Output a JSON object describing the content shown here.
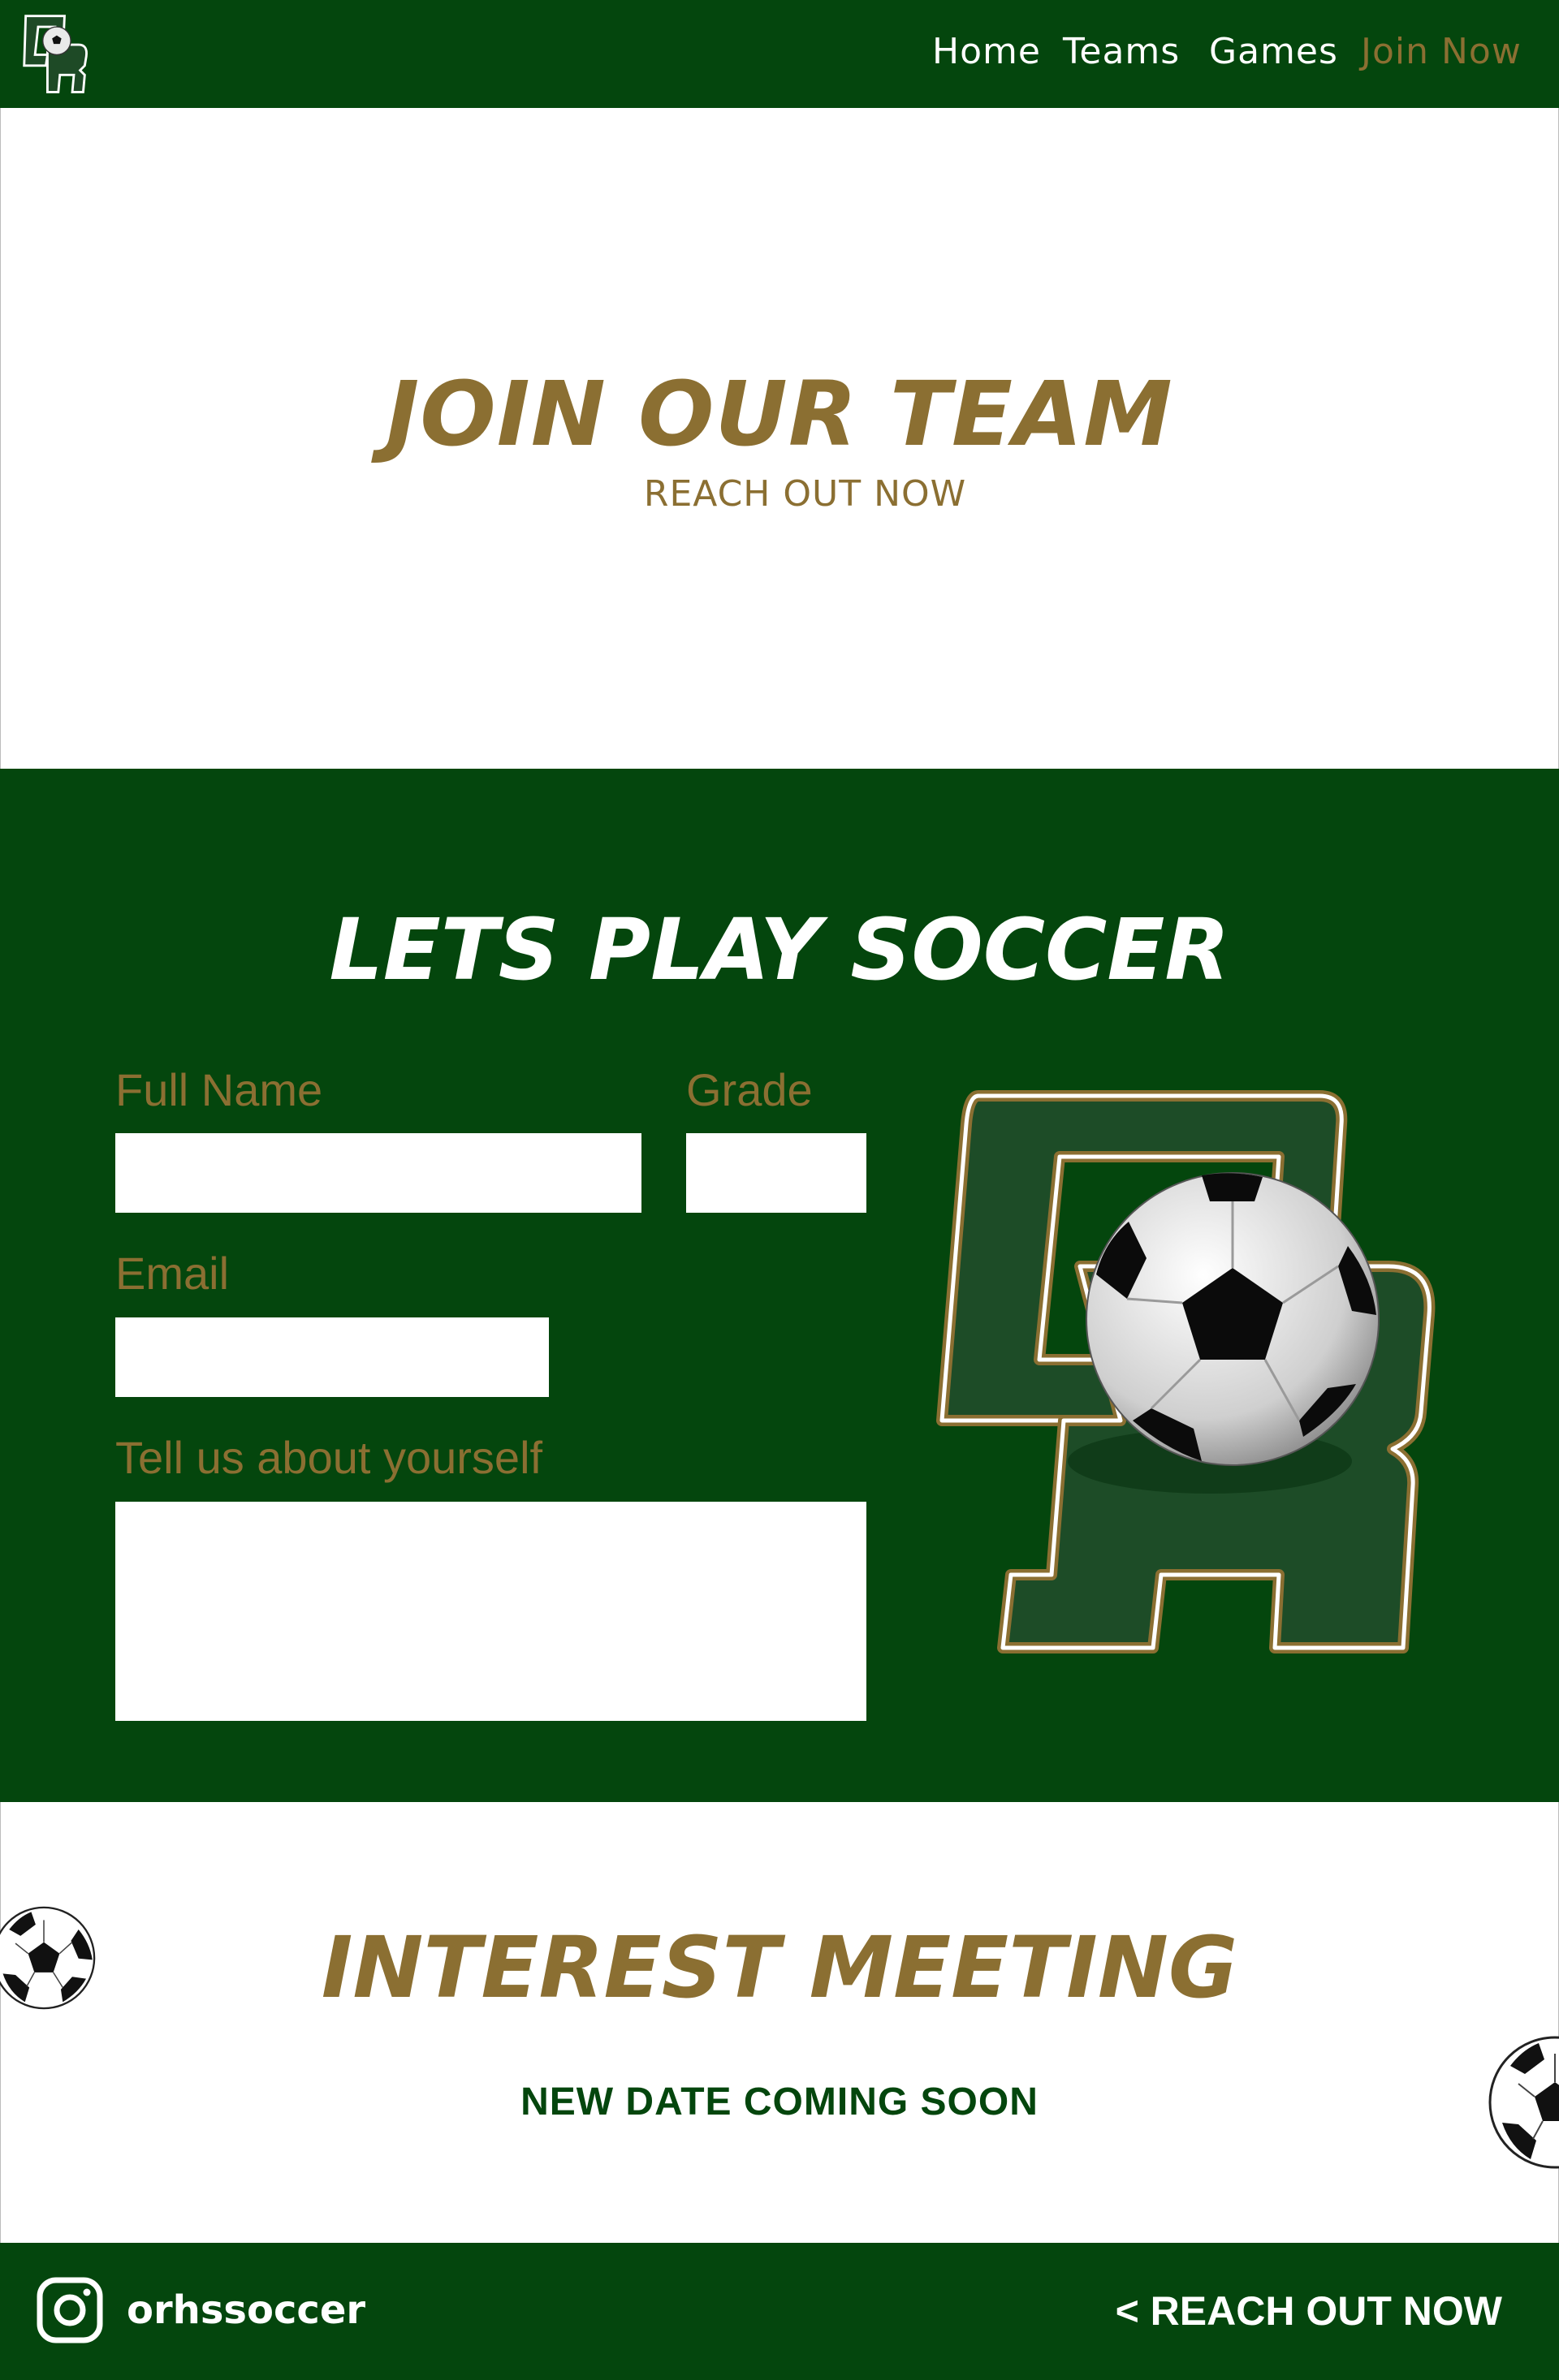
{
  "colors": {
    "brand_green": "#04460d",
    "brand_gold": "#8b6f32",
    "white": "#ffffff"
  },
  "nav": {
    "logo_icon": "or-soccer-logo-icon",
    "links": [
      {
        "label": "Home"
      },
      {
        "label": "Teams"
      },
      {
        "label": "Games"
      },
      {
        "label": "Join Now",
        "active": true
      }
    ]
  },
  "hero": {
    "title": "JOIN OUR TEAM",
    "subtitle": "REACH OUT NOW"
  },
  "form": {
    "title": "LETS PLAY SOCCER",
    "full_name_label": "Full Name",
    "full_name_value": "",
    "grade_label": "Grade",
    "grade_value": "",
    "email_label": "Email",
    "email_value": "",
    "about_label": "Tell us about yourself",
    "about_value": "",
    "logo_icon": "or-soccer-logo-icon"
  },
  "meeting": {
    "title": "INTEREST MEETING",
    "date_text": "NEW DATE COMING SOON",
    "decor_icons": [
      "soccer-ball-icon",
      "soccer-ball-icon"
    ]
  },
  "footer": {
    "instagram_icon": "instagram-icon",
    "instagram_handle": "orhssoccer",
    "cta": "< REACH OUT NOW"
  }
}
